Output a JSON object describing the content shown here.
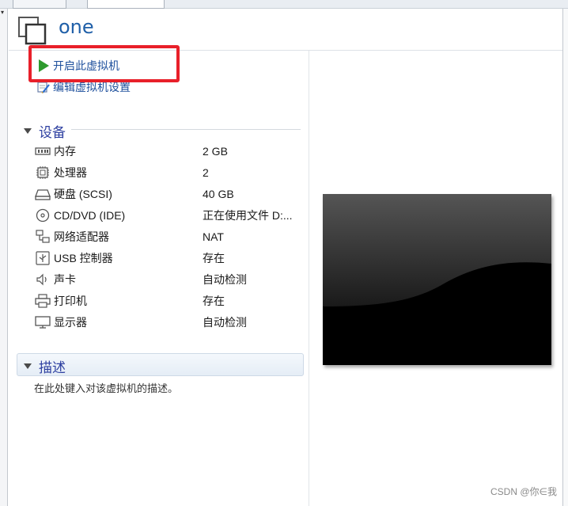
{
  "vm": {
    "name": "one"
  },
  "actions": {
    "start": "开启此虚拟机",
    "edit": "编辑虚拟机设置"
  },
  "sections": {
    "devices": "设备",
    "description": "描述"
  },
  "devices": [
    {
      "icon": "memory-icon",
      "name": "内存",
      "value": "2 GB"
    },
    {
      "icon": "processor-icon",
      "name": "处理器",
      "value": "2"
    },
    {
      "icon": "hard-disk-icon",
      "name": "硬盘 (SCSI)",
      "value": "40 GB"
    },
    {
      "icon": "cd-dvd-icon",
      "name": "CD/DVD (IDE)",
      "value": "正在使用文件 D:..."
    },
    {
      "icon": "network-adapter-icon",
      "name": "网络适配器",
      "value": "NAT"
    },
    {
      "icon": "usb-icon",
      "name": "USB 控制器",
      "value": "存在"
    },
    {
      "icon": "sound-card-icon",
      "name": "声卡",
      "value": "自动检测"
    },
    {
      "icon": "printer-icon",
      "name": "打印机",
      "value": "存在"
    },
    {
      "icon": "display-icon",
      "name": "显示器",
      "value": "自动检测"
    }
  ],
  "description": {
    "placeholder": "在此处键入对该虚拟机的描述。"
  },
  "watermark": "CSDN @你∈我",
  "colors": {
    "highlight": "#e8202a",
    "link": "#1d4f9c",
    "section": "#2d3fa0",
    "start_green": "#2e9a2e"
  }
}
